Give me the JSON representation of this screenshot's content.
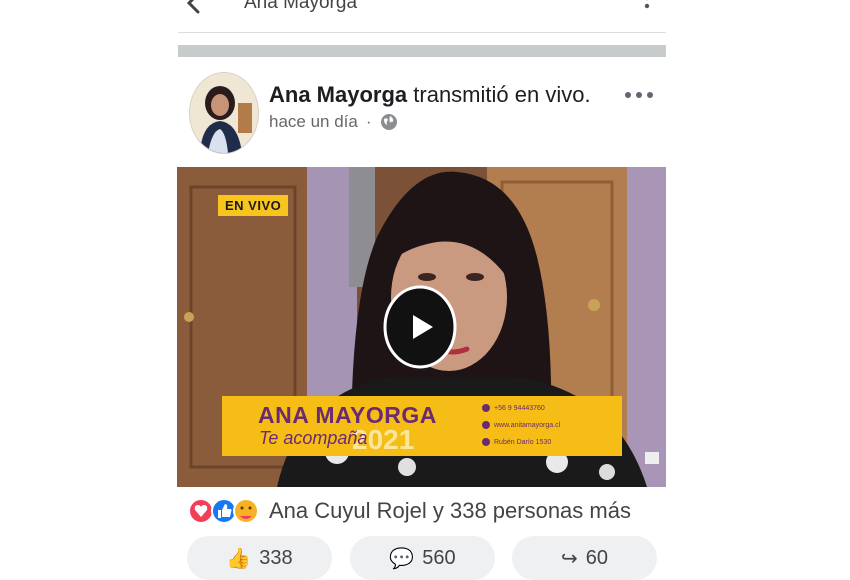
{
  "topbar": {
    "title": "Ana Mayorga"
  },
  "post": {
    "author": "Ana Mayorga",
    "action": " transmitió en vivo.",
    "time": "hace un día",
    "separator": "·"
  },
  "video": {
    "live_badge": "EN VIVO",
    "banner_name": "ANA MAYORGA",
    "banner_sub": "Te acompaña",
    "banner_year": "2021",
    "contacts": [
      "+56 9 94443760",
      "www.anitamayorga.cl",
      "Rubén Darío 1530"
    ]
  },
  "reactions": {
    "summary": "Ana Cuyul Rojel y 338 personas más",
    "icons": [
      "heart-reaction",
      "like-reaction",
      "care-reaction"
    ]
  },
  "actions": {
    "like_count": "338",
    "comment_count": "560",
    "share_count": "60"
  },
  "colors": {
    "live_badge": "#f7c51e",
    "banner": "#f6bd16",
    "banner_text": "#6a2b70"
  }
}
